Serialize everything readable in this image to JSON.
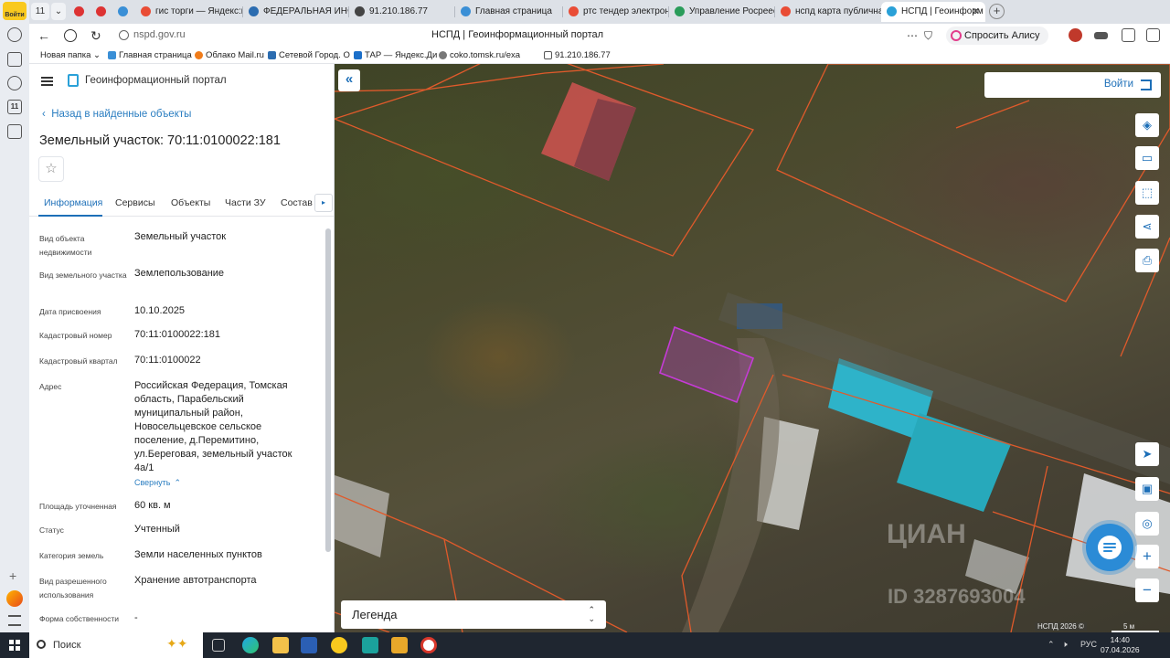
{
  "browser": {
    "yandex_badge": "Войти",
    "tab_count": "11",
    "tabs": [
      {
        "label": "гис торги — Яндекс:н",
        "color": "#e94c35"
      },
      {
        "label": "ФЕДЕРАЛЬНАЯ ИНФ",
        "color": "#2b6cb0"
      },
      {
        "label": "91.210.186.77",
        "color": "#444444"
      },
      {
        "label": "Главная страница",
        "color": "#3a8fd6"
      },
      {
        "label": "ртс тендер электрон",
        "color": "#e94c35"
      },
      {
        "label": "Управление Росреес",
        "color": "#2a9c5a"
      },
      {
        "label": "нспд карта публична",
        "color": "#e94c35"
      },
      {
        "label": "НСПД | Геоинформ",
        "color": "#2aa1d8"
      }
    ],
    "url": "nspd.gov.ru",
    "page_title": "НСПД | Геоинформационный портал",
    "alisa_label": "Спросить Алису AI",
    "bookmarks": [
      {
        "label": "Новая папка",
        "color": ""
      },
      {
        "label": "Главная страница",
        "color": "#3a8fd6"
      },
      {
        "label": "Облако Mail.ru",
        "color": "#f07c1a"
      },
      {
        "label": "Сетевой Город. О",
        "color": "#2b6cb0"
      },
      {
        "label": "ТАР — Яндекс.Ди",
        "color": "#1b6fc9"
      },
      {
        "label": "coko.tomsk.ru/exa",
        "color": "#777777"
      },
      {
        "label": "91.210.186.77",
        "color": "#444444"
      }
    ]
  },
  "panel": {
    "portal_name": "Геоинформационный портал",
    "back_link": "Назад в найденные объекты",
    "title": "Земельный участок: 70:11:0100022:181",
    "star_icon": "☆",
    "tabs": [
      "Информация",
      "Сервисы",
      "Объекты",
      "Части ЗУ",
      "Состав"
    ],
    "tab_scroll_icon": "▸",
    "properties": [
      {
        "label": "Вид объекта недвижимости",
        "value": "Земельный участок"
      },
      {
        "label": "Вид земельного участка",
        "value": "Землепользование"
      },
      {
        "label": "Дата присвоения",
        "value": "10.10.2025"
      },
      {
        "label": "Кадастровый номер",
        "value": "70:11:0100022:181"
      },
      {
        "label": "Кадастровый квартал",
        "value": "70:11:0100022"
      },
      {
        "label": "Адрес",
        "value": "Российская Федерация, Томская область, Парабельский муниципальный район, Новосельцевское сельское поселение, д.Перемитино, ул.Береговая, земельный участок 4а/1"
      },
      {
        "label": "Площадь уточненная",
        "value": "60 кв. м"
      },
      {
        "label": "Статус",
        "value": "Учтенный"
      },
      {
        "label": "Категория земель",
        "value": "Земли населенных пунктов"
      },
      {
        "label": "Вид разрешенного использования",
        "value": "Хранение автотранспорта"
      },
      {
        "label": "Форма собственности",
        "value": "-"
      }
    ],
    "collapse_label": "Свернуть",
    "collapse_icon": "⌃"
  },
  "map": {
    "collapse_icon": "«",
    "login_label": "Войти",
    "tools": [
      "layers-icon",
      "ruler-icon",
      "select-area-icon",
      "share-icon",
      "print-icon",
      "locate-icon",
      "minimap-icon",
      "geolocation-icon",
      "zoom-in-icon",
      "zoom-out-icon"
    ],
    "tool_glyphs": [
      "◈",
      "▭",
      "⬚",
      "⋖",
      "⎙",
      "➤",
      "▣",
      "◎",
      "+",
      "−"
    ],
    "legend_label": "Легенда",
    "copyright": "НСПД 2026 ©",
    "scale_label": "5 м",
    "watermark": "ЦИАН",
    "watermark_id": "ID 3287693004",
    "parcel_color": "#e05a2b",
    "selected_parcel_color": "#c53bd6"
  },
  "taskbar": {
    "search_label": "Поиск",
    "lang": "РУС",
    "time": "14:40",
    "date": "07.04.2026"
  }
}
